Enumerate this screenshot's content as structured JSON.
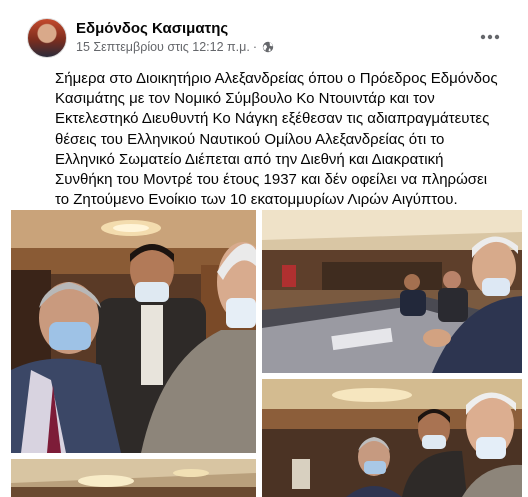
{
  "post": {
    "author": "Εδμόνδος Κασιματης",
    "date": "15 Σεπτεμβρίου στις 12:12 π.μ.",
    "separator": "·",
    "privacy_icon": "globe-icon",
    "more_icon": "more-horizontal-icon",
    "text": "Σήμερα στο Διοικητήριο Αλεξανδρείας όπου ο Πρόεδρος Εδμόνδος Κασιμάτης με τον Νομικό Σύμβουλο Κο Ντουιντάρ και τον Εκτελεστηκό Διευθυντή Κο Νάγκη εξέθεσαν τις αδιαπραγμάτευτες θέσεις του Ελληνικού Ναυτικού Ομίλου Αλεξανδρείας ότι το Ελληνικό Σωματείο Διέπεται από την Διεθνή και Διακρατική Συνθήκη του Μοντρέ του έτους 1937 και δέν οφείλει να πληρώσει το Ζητούμενο Ενοίκιο των 10 εκατομμυρίων Λιρών Αιγύπτου."
  },
  "colors": {
    "text": "#050505",
    "secondary": "#65676b",
    "background": "#ffffff"
  }
}
